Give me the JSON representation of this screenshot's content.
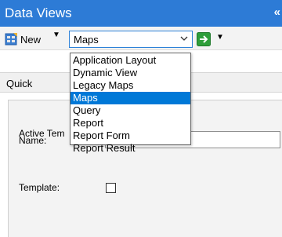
{
  "panel_title": "Data Views",
  "toolbar": {
    "new_label": "New",
    "view_type_selected": "Maps"
  },
  "tabs": {
    "quick_label": "Quick"
  },
  "form": {
    "active_template_label": "Active Tem",
    "name_label": "Name:",
    "name_value": "",
    "template_label": "Template:",
    "template_checked": false
  },
  "dropdown": {
    "items": [
      {
        "label": "Application Layout",
        "selected": false
      },
      {
        "label": "Dynamic View",
        "selected": false
      },
      {
        "label": "Legacy Maps",
        "selected": false
      },
      {
        "label": "Maps",
        "selected": true
      },
      {
        "label": "Query",
        "selected": false
      },
      {
        "label": "Report",
        "selected": false
      },
      {
        "label": "Report Form",
        "selected": false
      },
      {
        "label": "Report Result",
        "selected": false
      }
    ]
  },
  "colors": {
    "titlebar": "#2d7bd6",
    "selection": "#0078d7",
    "go_green": "#2e9e3a"
  },
  "icons": [
    "new-document-icon",
    "dropdown-arrow-icon",
    "chevron-down-icon",
    "go-arrow-icon",
    "collapse-icon"
  ]
}
